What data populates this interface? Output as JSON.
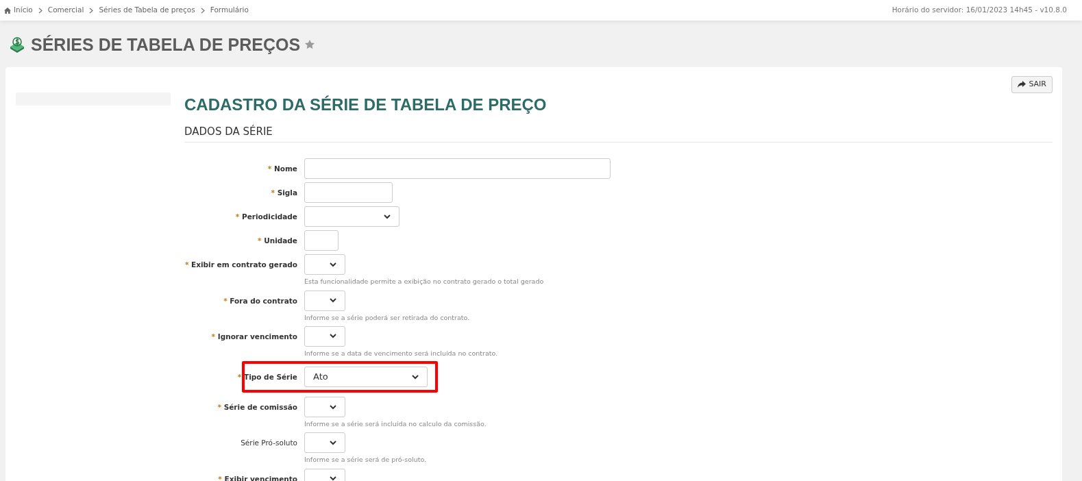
{
  "breadcrumb": [
    {
      "label": "Início",
      "kind": "home"
    },
    {
      "label": "Comercial",
      "kind": "link"
    },
    {
      "label": "Séries de Tabela de preços",
      "kind": "link"
    },
    {
      "label": "Formulário",
      "kind": "link"
    }
  ],
  "server_info": "Horário do servidor: 16/01/2023 14h45 - v10.8.0",
  "page_title": "SÉRIES DE TABELA DE PREÇOS",
  "favorite": false,
  "exit_button": "SAIR",
  "form_title": "CADASTRO DA SÉRIE DE TABELA DE PREÇO",
  "section_title": "DADOS DA SÉRIE",
  "required_marker": "*",
  "fields": [
    {
      "label": "Nome",
      "required": true,
      "kind": "text-long",
      "highlighted": false
    },
    {
      "label": "Sigla",
      "required": true,
      "kind": "text-short",
      "highlighted": false
    },
    {
      "label": "Periodicidade",
      "required": true,
      "kind": "select-medium",
      "highlighted": false
    },
    {
      "label": "Unidade",
      "required": true,
      "kind": "text-tiny",
      "highlighted": false
    },
    {
      "label": "Exibir em contrato gerado",
      "required": true,
      "kind": "select-small",
      "highlighted": false,
      "hint": "Esta funcionalidade permite a exibição no contrato gerado o total gerado"
    },
    {
      "label": "Fora do contrato",
      "required": true,
      "kind": "select-small",
      "highlighted": false,
      "hint": "Informe se a série poderá ser retirada do contrato."
    },
    {
      "label": "Ignorar vencimento",
      "required": true,
      "kind": "select-small",
      "highlighted": false,
      "hint": "Informe se a data de vencimento será incluída no contrato."
    },
    {
      "label": "Tipo de Série",
      "required": true,
      "kind": "select-long",
      "highlighted": true,
      "value": "Ato"
    },
    {
      "label": "Série de comissão",
      "required": true,
      "kind": "select-small",
      "highlighted": false,
      "hint": "Informe se a série será incluída no calculo da comissão."
    },
    {
      "label": "Série Pró-soluto",
      "required": false,
      "kind": "select-small",
      "highlighted": false,
      "hint": "Informe se a série será de pró-soluto."
    },
    {
      "label": "Exibir vencimento",
      "required": true,
      "kind": "select-small",
      "highlighted": false
    }
  ]
}
